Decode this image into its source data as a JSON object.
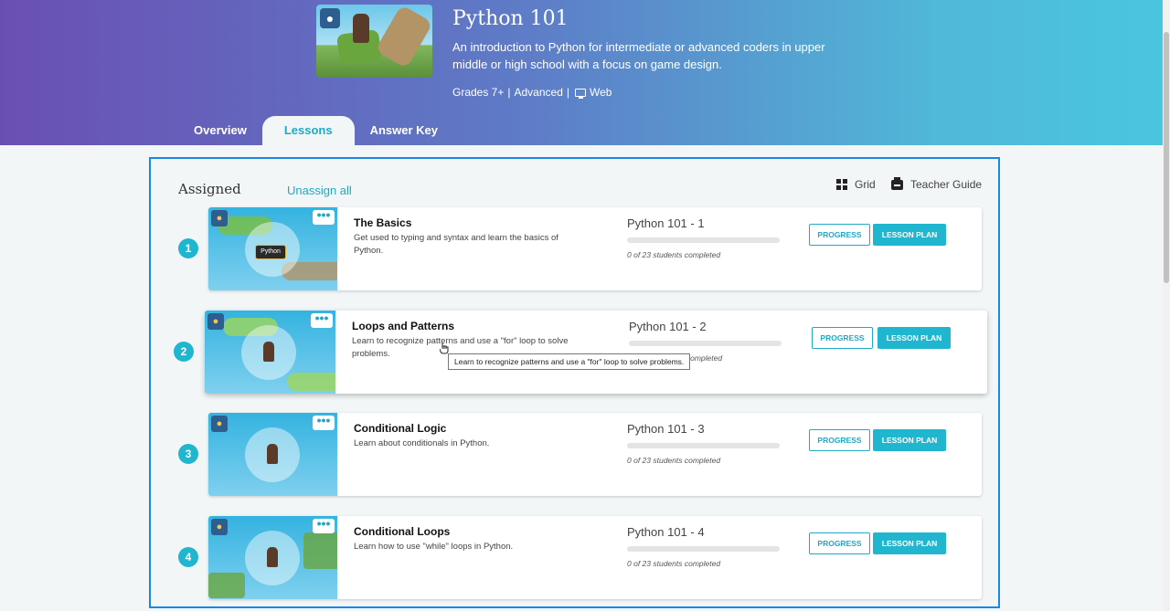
{
  "course": {
    "title": "Python 101",
    "description": "An introduction to Python for intermediate or advanced coders in upper middle or high school with a focus on game design.",
    "grades": "Grades 7+",
    "separator": "|",
    "level": "Advanced",
    "platform": "Web"
  },
  "tabs": [
    {
      "label": "Overview",
      "active": false
    },
    {
      "label": "Lessons",
      "active": true
    },
    {
      "label": "Answer Key",
      "active": false
    }
  ],
  "section": {
    "title": "Assigned",
    "unassign_label": "Unassign all",
    "grid_label": "Grid",
    "guide_label": "Teacher Guide"
  },
  "lessons": [
    {
      "number": "1",
      "name": "The Basics",
      "description": "Get used to typing and syntax and learn the basics of Python.",
      "code": "Python 101 - 1",
      "completed": "0 of 23 students completed",
      "progress": 0,
      "thumb_tag": "Python"
    },
    {
      "number": "2",
      "name": "Loops and Patterns",
      "description": "Learn to recognize patterns and use a \"for\" loop to solve problems.",
      "code": "Python 101 - 2",
      "completed": "0 of 23 students completed",
      "progress": 0
    },
    {
      "number": "3",
      "name": "Conditional Logic",
      "description": "Learn about conditionals in Python.",
      "code": "Python 101 - 3",
      "completed": "0 of 23 students completed",
      "progress": 0
    },
    {
      "number": "4",
      "name": "Conditional Loops",
      "description": "Learn how to use \"while\" loops in Python.",
      "code": "Python 101 - 4",
      "completed": "0 of 23 students completed",
      "progress": 0
    }
  ],
  "buttons": {
    "progress": "PROGRESS",
    "lesson_plan": "LESSON PLAN",
    "more": "•••"
  },
  "tooltip": "Learn to recognize patterns and use a \"for\" loop to solve problems.",
  "colors": {
    "accent": "#20b6cf",
    "panel_border": "#1b86e6",
    "header_start": "#6a4fb3",
    "header_end": "#49c6e0"
  },
  "icons": {
    "python_badge": "python-logo-icon",
    "monitor": "monitor-icon",
    "grid": "grid-icon",
    "printer": "printer-icon"
  }
}
